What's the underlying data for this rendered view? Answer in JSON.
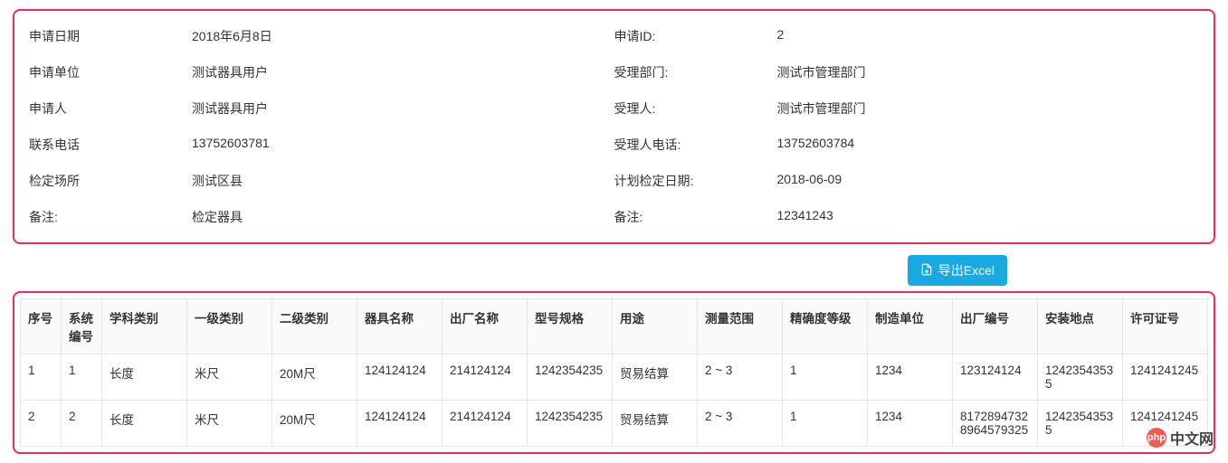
{
  "info": {
    "left": [
      {
        "label": "申请日期",
        "value": "2018年6月8日"
      },
      {
        "label": "申请单位",
        "value": "测试器具用户"
      },
      {
        "label": "申请人",
        "value": "测试器具用户"
      },
      {
        "label": "联系电话",
        "value": "13752603781"
      },
      {
        "label": "检定场所",
        "value": "测试区县"
      },
      {
        "label": "备注:",
        "value": "检定器具"
      }
    ],
    "right": [
      {
        "label": "申请ID:",
        "value": "2"
      },
      {
        "label": "受理部门:",
        "value": "测试市管理部门"
      },
      {
        "label": "受理人:",
        "value": "测试市管理部门"
      },
      {
        "label": "受理人电话:",
        "value": "13752603784"
      },
      {
        "label": "计划检定日期:",
        "value": "2018-06-09"
      },
      {
        "label": "备注:",
        "value": "12341243"
      }
    ]
  },
  "toolbar": {
    "export_label": "导出Excel"
  },
  "table": {
    "headers": [
      "序号",
      "系统编号",
      "学科类别",
      "一级类别",
      "二级类别",
      "器具名称",
      "出厂名称",
      "型号规格",
      "用途",
      "测量范围",
      "精确度等级",
      "制造单位",
      "出厂编号",
      "安装地点",
      "许可证号"
    ],
    "rows": [
      [
        "1",
        "1",
        "长度",
        "米尺",
        "20M尺",
        "124124124",
        "214124124",
        "1242354235",
        "贸易结算",
        "2 ~ 3",
        "1",
        "1234",
        "123124124",
        "12423543535",
        "1241241245"
      ],
      [
        "2",
        "2",
        "长度",
        "米尺",
        "20M尺",
        "124124124",
        "214124124",
        "1242354235",
        "贸易结算",
        "2 ~ 3",
        "1",
        "1234",
        "81728947328964579325",
        "12423543535",
        "1241241245"
      ]
    ]
  },
  "watermark": {
    "logo_text": "php",
    "text": "中文网"
  }
}
